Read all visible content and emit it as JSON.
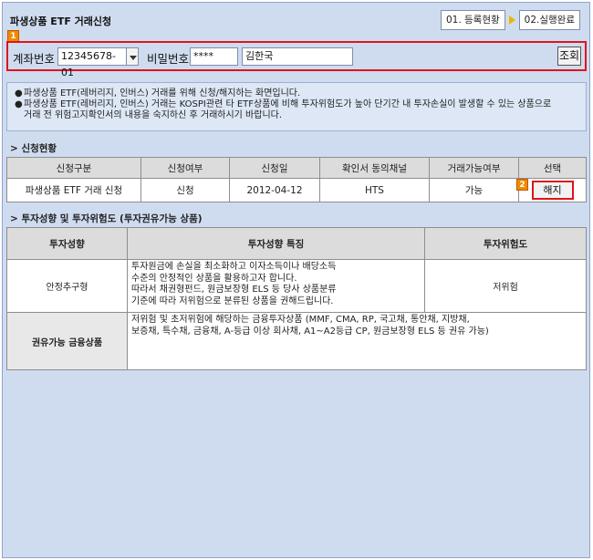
{
  "title": "파생상품 ETF 거래신청",
  "steps": [
    {
      "label": "01. 등록현황"
    },
    {
      "label": "02.실행완료"
    }
  ],
  "badges": {
    "one": "1",
    "two": "2"
  },
  "account_bar": {
    "account_label": "계좌번호",
    "account_value": "12345678-01",
    "password_label": "비밀번호",
    "password_value": "****",
    "name_value": "김한국",
    "query_button": "조회"
  },
  "notice": {
    "bullet": "●",
    "line1": "파생상품 ETF(레버리지, 인버스) 거래를 위해 신청/해지하는 화면입니다.",
    "line2": "파생상품 ETF(레버리지, 인버스) 거래는 KOSPI관련 타 ETF상품에 비해 투자위험도가 높아 단기간 내 투자손실이 발생할 수 있는 상품으로",
    "line3": "거래 전 위험고지확인서의 내용을 숙지하신 후 거래하시기 바랍니다."
  },
  "section1": {
    "heading": "> 신청현황",
    "headers": [
      "신청구분",
      "신청여부",
      "신청일",
      "확인서 동의채널",
      "거래가능여부",
      "선택"
    ],
    "row": {
      "type": "파생상품 ETF 거래 신청",
      "status": "신청",
      "date": "2012-04-12",
      "channel": "HTS",
      "tradable": "가능",
      "action": "해지"
    }
  },
  "section2": {
    "heading": "> 투자성향 및 투자위험도 (투자권유가능 상품)",
    "headers": [
      "투자성향",
      "투자성향 특징",
      "투자위험도"
    ],
    "row1": {
      "type": "안정추구형",
      "desc1": "투자원금에 손실을 최소화하고 이자소득이나 배당소득",
      "desc2": "수준의 안정적인 상품을 활용하고자 합니다.",
      "desc3": "따라서 채권형펀드, 원금보장형 ELS 등 당사 상품분류",
      "desc4": "기준에 따라 저위험으로 분류된 상품을 권해드립니다.",
      "risk": "저위험"
    },
    "row2": {
      "label": "권유가능 금융상품",
      "desc1": "저위험 및 초저위험에 해당하는 금융투자상품 (MMF, CMA, RP, 국고채, 통안채, 지방채,",
      "desc2": "보증채, 특수채, 금융채, A-등급 이상 회사채, A1~A2등급 CP, 원금보장형 ELS 등 권유 가능)"
    }
  }
}
